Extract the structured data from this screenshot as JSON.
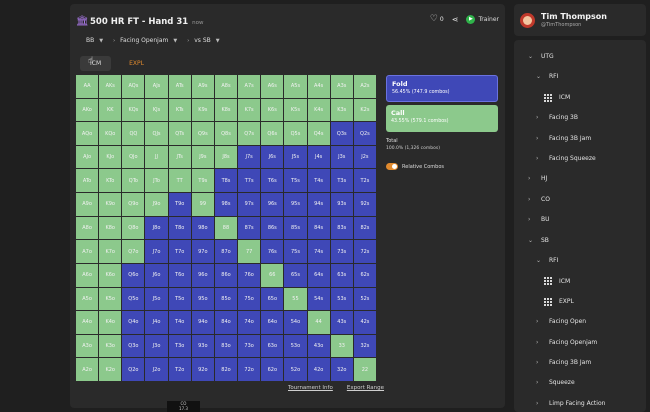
{
  "header": {
    "title": "500 HR FT - Hand 31",
    "time": "now",
    "likes": "0",
    "trainer_label": "Trainer"
  },
  "filters": [
    {
      "label": "BB"
    },
    {
      "label": "Facing Openjam"
    },
    {
      "label": "vs SB"
    }
  ],
  "tabs": [
    {
      "label": "ICM",
      "active": true
    },
    {
      "label": "EXPL",
      "active": false
    }
  ],
  "grid": {
    "rows": [
      [
        [
          "AA",
          "c"
        ],
        [
          "AKs",
          "c"
        ],
        [
          "AQs",
          "c"
        ],
        [
          "AJs",
          "c"
        ],
        [
          "ATs",
          "c"
        ],
        [
          "A9s",
          "c"
        ],
        [
          "A8s",
          "c"
        ],
        [
          "A7s",
          "c"
        ],
        [
          "A6s",
          "c"
        ],
        [
          "A5s",
          "c"
        ],
        [
          "A4s",
          "c"
        ],
        [
          "A3s",
          "c"
        ],
        [
          "A2s",
          "c"
        ]
      ],
      [
        [
          "AKo",
          "c"
        ],
        [
          "KK",
          "c"
        ],
        [
          "KQs",
          "c"
        ],
        [
          "KJs",
          "c"
        ],
        [
          "KTs",
          "c"
        ],
        [
          "K9s",
          "c"
        ],
        [
          "K8s",
          "c"
        ],
        [
          "K7s",
          "c"
        ],
        [
          "K6s",
          "c"
        ],
        [
          "K5s",
          "c"
        ],
        [
          "K4s",
          "c"
        ],
        [
          "K3s",
          "c"
        ],
        [
          "K2s",
          "c"
        ]
      ],
      [
        [
          "AQo",
          "c"
        ],
        [
          "KQo",
          "c"
        ],
        [
          "QQ",
          "c"
        ],
        [
          "QJs",
          "c"
        ],
        [
          "QTs",
          "c"
        ],
        [
          "Q9s",
          "c"
        ],
        [
          "Q8s",
          "c"
        ],
        [
          "Q7s",
          "c"
        ],
        [
          "Q6s",
          "c"
        ],
        [
          "Q5s",
          "c"
        ],
        [
          "Q4s",
          "c"
        ],
        [
          "Q3s",
          "f"
        ],
        [
          "Q2s",
          "f"
        ]
      ],
      [
        [
          "AJo",
          "c"
        ],
        [
          "KJo",
          "c"
        ],
        [
          "QJo",
          "c"
        ],
        [
          "JJ",
          "c"
        ],
        [
          "JTs",
          "c"
        ],
        [
          "J9s",
          "c"
        ],
        [
          "J8s",
          "c"
        ],
        [
          "J7s",
          "f"
        ],
        [
          "J6s",
          "f"
        ],
        [
          "J5s",
          "f"
        ],
        [
          "J4s",
          "f"
        ],
        [
          "J3s",
          "f"
        ],
        [
          "J2s",
          "f"
        ]
      ],
      [
        [
          "ATo",
          "c"
        ],
        [
          "KTo",
          "c"
        ],
        [
          "QTo",
          "c"
        ],
        [
          "JTo",
          "c"
        ],
        [
          "TT",
          "c"
        ],
        [
          "T9s",
          "c"
        ],
        [
          "T8s",
          "f"
        ],
        [
          "T7s",
          "f"
        ],
        [
          "T6s",
          "f"
        ],
        [
          "T5s",
          "f"
        ],
        [
          "T4s",
          "f"
        ],
        [
          "T3s",
          "f"
        ],
        [
          "T2s",
          "f"
        ]
      ],
      [
        [
          "A9o",
          "c"
        ],
        [
          "K9o",
          "c"
        ],
        [
          "Q9o",
          "c"
        ],
        [
          "J9o",
          "c"
        ],
        [
          "T9o",
          "f"
        ],
        [
          "99",
          "c"
        ],
        [
          "98s",
          "f"
        ],
        [
          "97s",
          "f"
        ],
        [
          "96s",
          "f"
        ],
        [
          "95s",
          "f"
        ],
        [
          "94s",
          "f"
        ],
        [
          "93s",
          "f"
        ],
        [
          "92s",
          "f"
        ]
      ],
      [
        [
          "A8o",
          "c"
        ],
        [
          "K8o",
          "c"
        ],
        [
          "Q8o",
          "c"
        ],
        [
          "J8o",
          "f"
        ],
        [
          "T8o",
          "f"
        ],
        [
          "98o",
          "f"
        ],
        [
          "88",
          "c"
        ],
        [
          "87s",
          "f"
        ],
        [
          "86s",
          "f"
        ],
        [
          "85s",
          "f"
        ],
        [
          "84s",
          "f"
        ],
        [
          "83s",
          "f"
        ],
        [
          "82s",
          "f"
        ]
      ],
      [
        [
          "A7o",
          "c"
        ],
        [
          "K7o",
          "c"
        ],
        [
          "Q7o",
          "c"
        ],
        [
          "J7o",
          "f"
        ],
        [
          "T7o",
          "f"
        ],
        [
          "97o",
          "f"
        ],
        [
          "87o",
          "f"
        ],
        [
          "77",
          "c"
        ],
        [
          "76s",
          "f"
        ],
        [
          "75s",
          "f"
        ],
        [
          "74s",
          "f"
        ],
        [
          "73s",
          "f"
        ],
        [
          "72s",
          "f"
        ]
      ],
      [
        [
          "A6o",
          "c"
        ],
        [
          "K6o",
          "c"
        ],
        [
          "Q6o",
          "f"
        ],
        [
          "J6o",
          "f"
        ],
        [
          "T6o",
          "f"
        ],
        [
          "96o",
          "f"
        ],
        [
          "86o",
          "f"
        ],
        [
          "76o",
          "f"
        ],
        [
          "66",
          "c"
        ],
        [
          "65s",
          "f"
        ],
        [
          "64s",
          "f"
        ],
        [
          "63s",
          "f"
        ],
        [
          "62s",
          "f"
        ]
      ],
      [
        [
          "A5o",
          "c"
        ],
        [
          "K5o",
          "c"
        ],
        [
          "Q5o",
          "f"
        ],
        [
          "J5o",
          "f"
        ],
        [
          "T5o",
          "f"
        ],
        [
          "95o",
          "f"
        ],
        [
          "85o",
          "f"
        ],
        [
          "75o",
          "f"
        ],
        [
          "65o",
          "f"
        ],
        [
          "55",
          "c"
        ],
        [
          "54s",
          "f"
        ],
        [
          "53s",
          "f"
        ],
        [
          "52s",
          "f"
        ]
      ],
      [
        [
          "A4o",
          "c"
        ],
        [
          "K4o",
          "c"
        ],
        [
          "Q4o",
          "f"
        ],
        [
          "J4o",
          "f"
        ],
        [
          "T4o",
          "f"
        ],
        [
          "94o",
          "f"
        ],
        [
          "84o",
          "f"
        ],
        [
          "74o",
          "f"
        ],
        [
          "64o",
          "f"
        ],
        [
          "54o",
          "f"
        ],
        [
          "44",
          "c"
        ],
        [
          "43s",
          "f"
        ],
        [
          "42s",
          "f"
        ]
      ],
      [
        [
          "A3o",
          "c"
        ],
        [
          "K3o",
          "c"
        ],
        [
          "Q3o",
          "f"
        ],
        [
          "J3o",
          "f"
        ],
        [
          "T3o",
          "f"
        ],
        [
          "93o",
          "f"
        ],
        [
          "83o",
          "f"
        ],
        [
          "73o",
          "f"
        ],
        [
          "63o",
          "f"
        ],
        [
          "53o",
          "f"
        ],
        [
          "43o",
          "f"
        ],
        [
          "33",
          "c"
        ],
        [
          "32s",
          "f"
        ]
      ],
      [
        [
          "A2o",
          "c"
        ],
        [
          "K2o",
          "c"
        ],
        [
          "Q2o",
          "f"
        ],
        [
          "J2o",
          "f"
        ],
        [
          "T2o",
          "f"
        ],
        [
          "92o",
          "f"
        ],
        [
          "82o",
          "f"
        ],
        [
          "72o",
          "f"
        ],
        [
          "62o",
          "f"
        ],
        [
          "52o",
          "f"
        ],
        [
          "42o",
          "f"
        ],
        [
          "32o",
          "f"
        ],
        [
          "22",
          "c"
        ]
      ]
    ],
    "colors": {
      "call": "#8cc98c",
      "fold": "#3f48b7"
    }
  },
  "actions": {
    "fold": {
      "label": "Fold",
      "stats": "56.45% (747.9 combos)"
    },
    "call": {
      "label": "Call",
      "stats": "43.55% (579.1 combos)"
    },
    "total_label": "Total",
    "total_stats": "100.0% (1,326 combos)",
    "relative_combos": "Relative Combos"
  },
  "links": {
    "tournament_info": "Tournament Info",
    "export_range": "Export Range"
  },
  "bottom_chip": {
    "line1": "CO",
    "line2": "17.3"
  },
  "profile": {
    "name": "Tim Thompson",
    "handle": "@TimThompson"
  },
  "tree": [
    {
      "label": "UTG",
      "chev": "v",
      "icon": "none",
      "indent": 0
    },
    {
      "label": "RFI",
      "chev": "v",
      "icon": "none",
      "indent": 1
    },
    {
      "label": "ICM",
      "chev": "",
      "icon": "grid",
      "indent": 2
    },
    {
      "label": "Facing 3B",
      "chev": ">",
      "icon": "none",
      "indent": 1
    },
    {
      "label": "Facing 3B Jam",
      "chev": ">",
      "icon": "none",
      "indent": 1
    },
    {
      "label": "Facing Squeeze",
      "chev": ">",
      "icon": "none",
      "indent": 1
    },
    {
      "label": "HJ",
      "chev": ">",
      "icon": "none",
      "indent": 0
    },
    {
      "label": "CO",
      "chev": ">",
      "icon": "none",
      "indent": 0
    },
    {
      "label": "BU",
      "chev": ">",
      "icon": "none",
      "indent": 0
    },
    {
      "label": "SB",
      "chev": "v",
      "icon": "none",
      "indent": 0
    },
    {
      "label": "RFI",
      "chev": "v",
      "icon": "none",
      "indent": 1
    },
    {
      "label": "ICM",
      "chev": "",
      "icon": "grid",
      "indent": 2
    },
    {
      "label": "EXPL",
      "chev": "",
      "icon": "grid",
      "indent": 2
    },
    {
      "label": "Facing Open",
      "chev": ">",
      "icon": "none",
      "indent": 1
    },
    {
      "label": "Facing Openjam",
      "chev": ">",
      "icon": "none",
      "indent": 1
    },
    {
      "label": "Facing 3B Jam",
      "chev": ">",
      "icon": "none",
      "indent": 1
    },
    {
      "label": "Squeeze",
      "chev": ">",
      "icon": "none",
      "indent": 1
    },
    {
      "label": "Limp Facing Action",
      "chev": ">",
      "icon": "none",
      "indent": 1
    }
  ]
}
